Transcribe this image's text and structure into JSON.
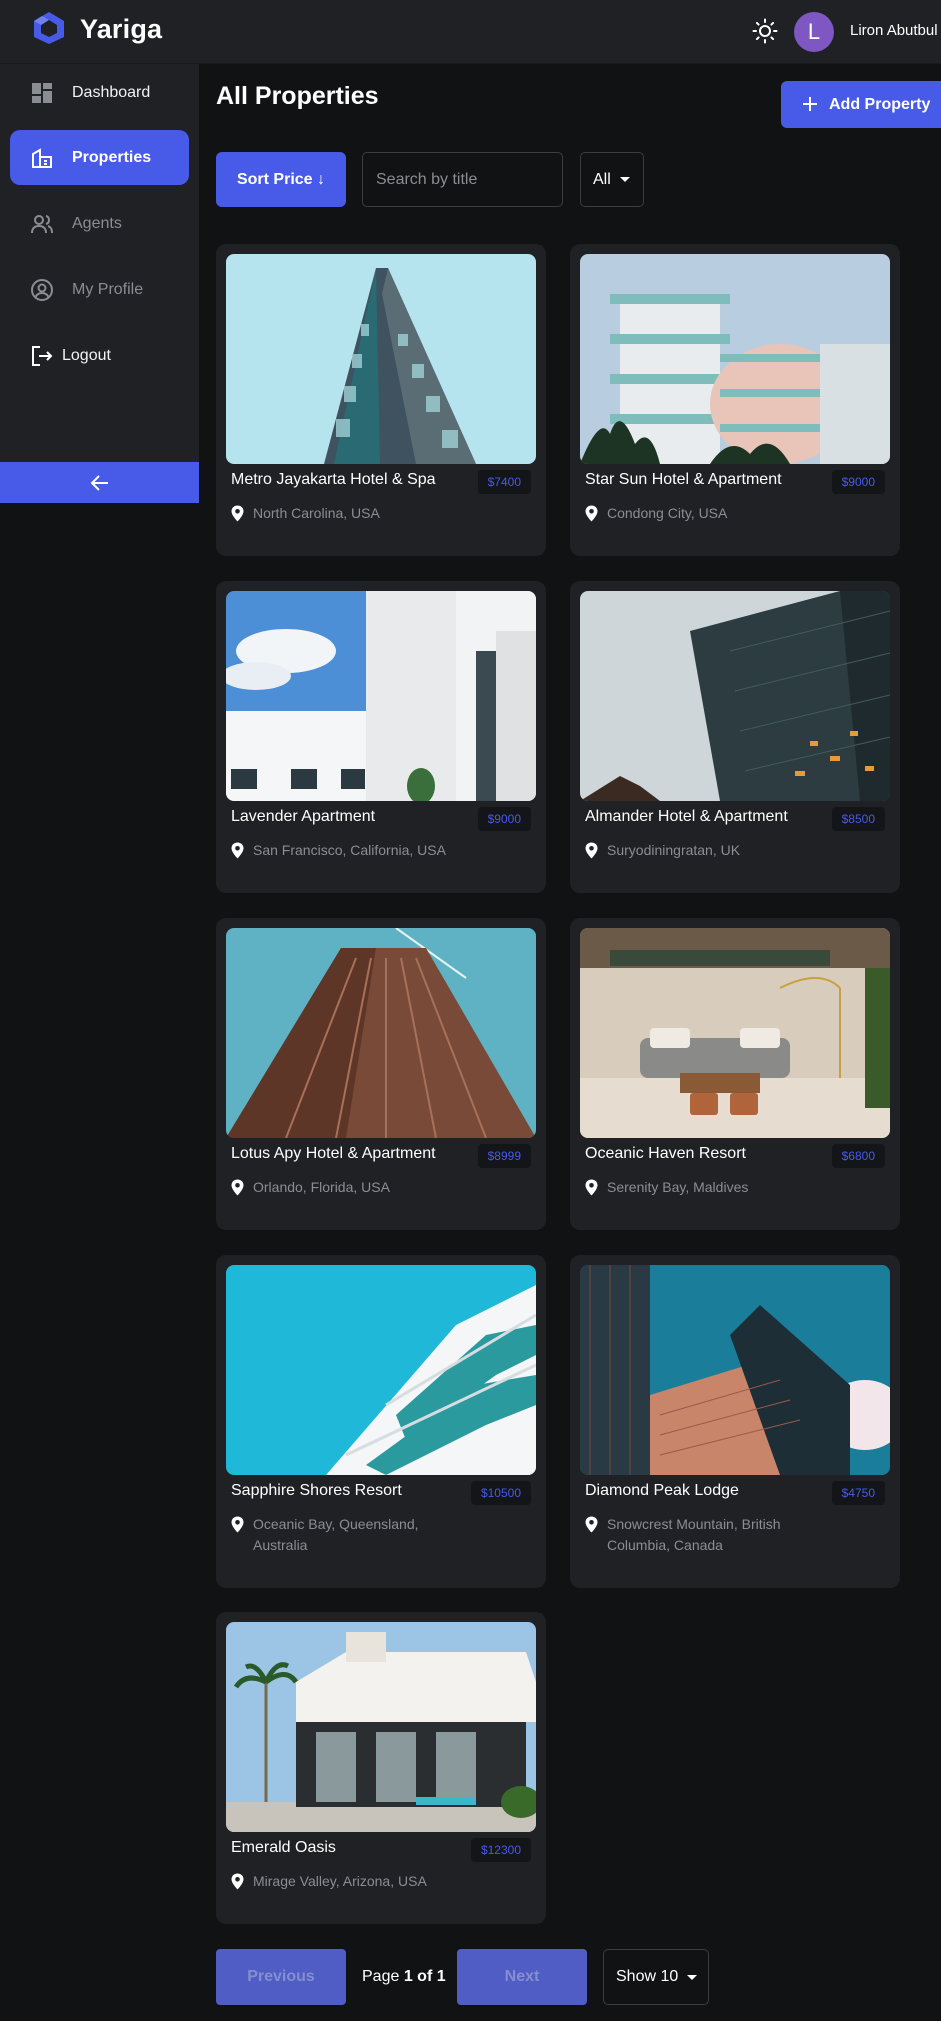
{
  "header": {
    "brand": "Yariga",
    "user": {
      "initial": "L",
      "name": "Liron Abutbul"
    }
  },
  "sidebar": {
    "items": [
      {
        "label": "Dashboard",
        "icon": "dashboard-icon"
      },
      {
        "label": "Properties",
        "icon": "properties-icon",
        "active": true
      },
      {
        "label": "Agents",
        "icon": "agents-icon"
      },
      {
        "label": "My Profile",
        "icon": "profile-icon"
      },
      {
        "label": "Logout",
        "icon": "logout-icon"
      }
    ],
    "collapse_icon": "arrow-left-icon"
  },
  "main": {
    "title": "All Properties",
    "add_button": "Add Property",
    "sort_button": "Sort Price ↓",
    "search_placeholder": "Search by title",
    "filter_value": "All"
  },
  "properties": [
    {
      "title": "Metro Jayakarta Hotel & Spa",
      "price": "$7400",
      "location": "North Carolina, USA"
    },
    {
      "title": "Star Sun Hotel & Apartment",
      "price": "$9000",
      "location": "Condong City, USA"
    },
    {
      "title": "Lavender Apartment",
      "price": "$9000",
      "location": "San Francisco, California, USA"
    },
    {
      "title": "Almander Hotel & Apartment",
      "price": "$8500",
      "location": "Suryodiningratan, UK"
    },
    {
      "title": "Lotus Apy Hotel & Apartment",
      "price": "$8999",
      "location": "Orlando, Florida, USA"
    },
    {
      "title": "Oceanic Haven Resort",
      "price": "$6800",
      "location": "Serenity Bay, Maldives"
    },
    {
      "title": "Sapphire Shores Resort",
      "price": "$10500",
      "location": "Oceanic Bay, Queensland, Australia"
    },
    {
      "title": "Diamond Peak Lodge",
      "price": "$4750",
      "location": "Snowcrest Mountain, British Columbia, Canada"
    },
    {
      "title": "Emerald Oasis",
      "price": "$12300",
      "location": "Mirage Valley, Arizona, USA"
    }
  ],
  "pagination": {
    "previous": "Previous",
    "page_prefix": "Page",
    "page_current": "1 of 1",
    "next": "Next",
    "show": "Show 10"
  },
  "colors": {
    "accent": "#475be8",
    "background": "#111214",
    "surface": "#1f2124"
  }
}
